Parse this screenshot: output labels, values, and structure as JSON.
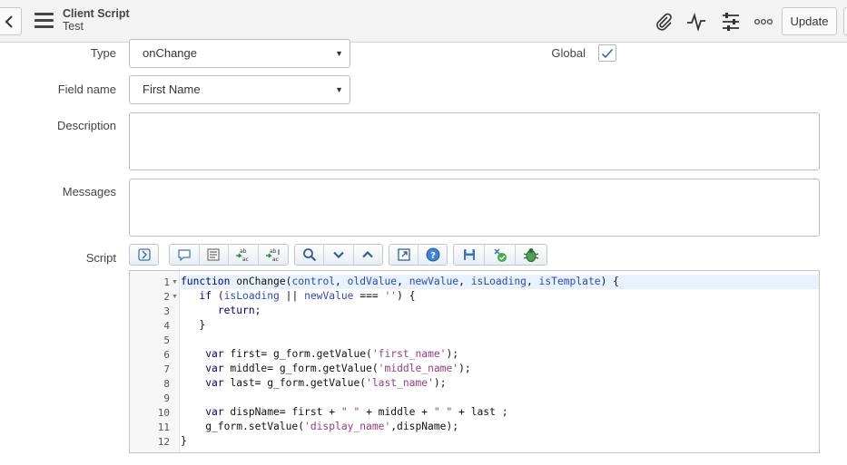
{
  "header": {
    "title": "Client Script",
    "subtitle": "Test",
    "update_label": "Update",
    "icons": [
      "chevron-left-icon",
      "hamburger-menu-icon",
      "paperclip-icon",
      "activity-pulse-icon",
      "sliders-icon",
      "more-options-icon"
    ]
  },
  "form": {
    "type": {
      "label": "Type",
      "value": "onChange"
    },
    "global": {
      "label": "Global",
      "checked": true
    },
    "field_name": {
      "label": "Field name",
      "value": "First Name"
    },
    "description": {
      "label": "Description",
      "value": ""
    },
    "messages": {
      "label": "Messages",
      "value": ""
    },
    "script": {
      "label": "Script"
    }
  },
  "toolbar": {
    "groups": [
      [
        "toggle-syntax-editor-icon"
      ],
      [
        "comment-icon",
        "format-code-icon",
        "replace-icon",
        "replace-all-icon"
      ],
      [
        "search-icon",
        "find-next-icon",
        "find-previous-icon"
      ],
      [
        "fullscreen-icon",
        "help-icon"
      ],
      [
        "save-icon",
        "validate-script-icon",
        "debug-icon"
      ]
    ]
  },
  "editor": {
    "line_numbers": [
      "1",
      "2",
      "3",
      "4",
      "5",
      "6",
      "7",
      "8",
      "9",
      "10",
      "11",
      "12"
    ],
    "lines": [
      "function onChange(control, oldValue, newValue, isLoading, isTemplate) {",
      "   if (isLoading || newValue === '') {",
      "      return;",
      "   }",
      "",
      "    var first= g_form.getValue('first_name');",
      "    var middle= g_form.getValue('middle_name');",
      "    var last= g_form.getValue('last_name');",
      "",
      "    var dispName= first + \" \" + middle + \" \" + last ;",
      "    g_form.setValue('display_name',dispName);",
      "}"
    ]
  },
  "colors": {
    "keyword": "#00008b",
    "param": "#2a4ab8",
    "string": "#9b3c7a",
    "active_line": "#e8f2fe",
    "checkmark": "#2e6db4"
  }
}
